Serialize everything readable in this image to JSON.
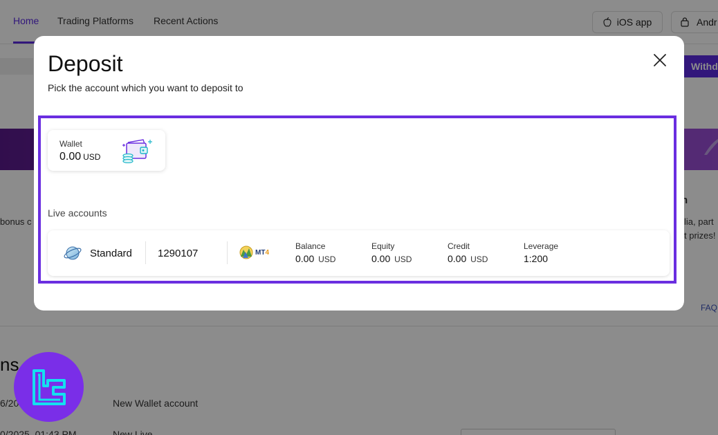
{
  "nav": {
    "tabs": [
      {
        "label": "Home",
        "active": true
      },
      {
        "label": "Trading Platforms",
        "active": false
      },
      {
        "label": "Recent Actions",
        "active": false
      }
    ],
    "ios_app_label": "iOS app",
    "user_label": "Andr",
    "withdraw_label": "Withd",
    "accent_color": "#5b2be0"
  },
  "background": {
    "bonus_text": "bonus c",
    "promo_text_1": "lia, part",
    "promo_text_2": "t prizes!",
    "promo_heading": "n",
    "faq_label": "FAQ",
    "section_heading": "ns",
    "recent_date_1": "6/20",
    "recent_action_1": "New Wallet account",
    "recent_date_2": "0/2025, 01:43 PM",
    "recent_action_2": "New Live"
  },
  "modal": {
    "title": "Deposit",
    "subtitle": "Pick the account which you want to deposit to",
    "close_icon": "close-icon",
    "highlight_color": "#6a2ee0",
    "wallet": {
      "label": "Wallet",
      "amount": "0.00",
      "currency": "USD",
      "icon": "wallet-icon"
    },
    "live_accounts_label": "Live accounts",
    "accounts": [
      {
        "type": "Standard",
        "number": "1290107",
        "platform": "MT4",
        "balance_label": "Balance",
        "balance": "0.00",
        "balance_currency": "USD",
        "equity_label": "Equity",
        "equity": "0.00",
        "equity_currency": "USD",
        "credit_label": "Credit",
        "credit": "0.00",
        "credit_currency": "USD",
        "leverage_label": "Leverage",
        "leverage": "1:200"
      }
    ]
  }
}
